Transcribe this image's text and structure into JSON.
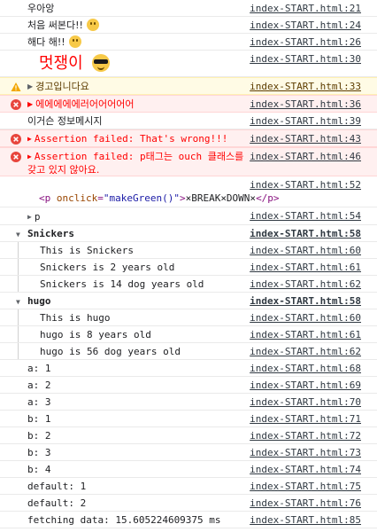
{
  "rows": [
    {
      "text": "우아앙",
      "source": "index-START.html:21"
    },
    {
      "text": "처음 써본다!!",
      "emoji": "grin-emoji",
      "source": "index-START.html:24"
    },
    {
      "text": "해다 해!!",
      "emoji": "grin-emoji",
      "source": "index-START.html:26"
    },
    {
      "text": "멋쟁이",
      "emoji": "sunglasses-emoji",
      "style_color": "#ff0000",
      "source": "index-START.html:30"
    },
    {
      "level": "warning",
      "text": "경고입니다요",
      "source": "index-START.html:33"
    },
    {
      "level": "error",
      "text": "에에에에에러어어어어어",
      "source": "index-START.html:36"
    },
    {
      "level": "info",
      "text": "이거슨 정보메시지",
      "source": "index-START.html:39"
    },
    {
      "level": "error",
      "text": "Assertion failed: That's wrong!!!",
      "source": "index-START.html:43"
    },
    {
      "level": "error",
      "text_line1": "Assertion failed: p태그는 ouch 클래스를",
      "text_line2": "갖고 있지 않아요.",
      "source": "index-START.html:46"
    },
    {
      "element": {
        "tag_open": "<p",
        "attr": "onclick",
        "eq": "=",
        "value": "\"makeGreen()\"",
        "close": ">",
        "content": "×BREAK×DOWN×",
        "tag_close": "</p>"
      },
      "source": "index-START.html:52"
    },
    {
      "text": "p",
      "collapsed": true,
      "source": "index-START.html:54"
    }
  ],
  "groups": [
    {
      "title": "Snickers",
      "source": "index-START.html:58",
      "items": [
        {
          "text": "This is Snickers",
          "source": "index-START.html:60"
        },
        {
          "text": "Snickers is 2 years old",
          "source": "index-START.html:61"
        },
        {
          "text": "Snickers is 14 dog years old",
          "source": "index-START.html:62"
        }
      ]
    },
    {
      "title": "hugo",
      "source": "index-START.html:58",
      "items": [
        {
          "text": "This is hugo",
          "source": "index-START.html:60"
        },
        {
          "text": "hugo is 8 years old",
          "source": "index-START.html:61"
        },
        {
          "text": "hugo is 56 dog years old",
          "source": "index-START.html:62"
        }
      ]
    }
  ],
  "counts": [
    {
      "text": "a: 1",
      "source": "index-START.html:68"
    },
    {
      "text": "a: 2",
      "source": "index-START.html:69"
    },
    {
      "text": "a: 3",
      "source": "index-START.html:70"
    },
    {
      "text": "b: 1",
      "source": "index-START.html:71"
    },
    {
      "text": "b: 2",
      "source": "index-START.html:72"
    },
    {
      "text": "b: 3",
      "source": "index-START.html:73"
    },
    {
      "text": "b: 4",
      "source": "index-START.html:74"
    },
    {
      "text": "default: 1",
      "source": "index-START.html:75"
    },
    {
      "text": "default: 2",
      "source": "index-START.html:76"
    },
    {
      "text": "fetching data: 15.605224609375 ms",
      "source": "index-START.html:85"
    }
  ],
  "colors": {
    "error": "#ff0000",
    "warning_bg": "#fffbe5",
    "error_bg": "#fff0f0",
    "warning_icon": "#f2a600",
    "error_icon": "#e8453c"
  }
}
